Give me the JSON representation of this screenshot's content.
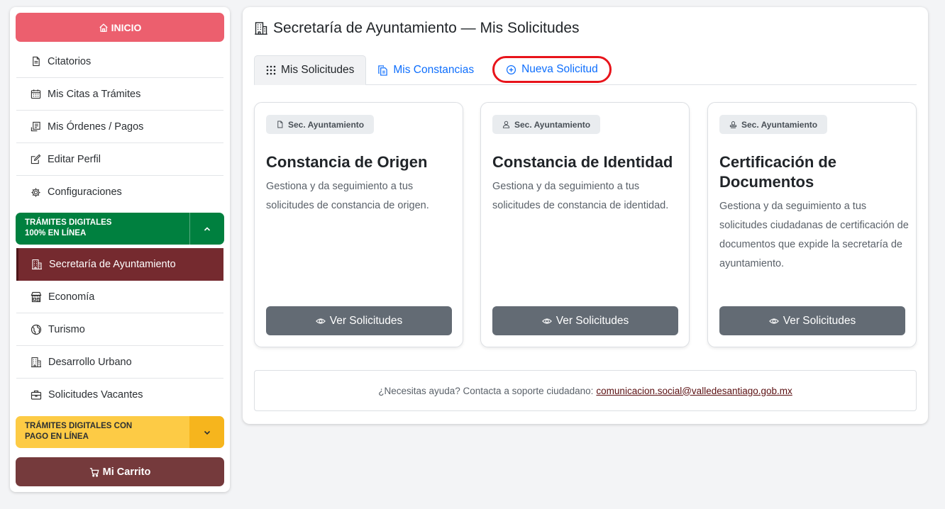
{
  "sidebar": {
    "inicio_label": "INICIO",
    "menu": [
      {
        "label": "Citatorios",
        "icon": "document-icon"
      },
      {
        "label": "Mis Citas a Trámites",
        "icon": "calendar-icon"
      },
      {
        "label": "Mis Órdenes / Pagos",
        "icon": "receipt-icon"
      },
      {
        "label": "Editar Perfil",
        "icon": "edit-icon"
      },
      {
        "label": "Configuraciones",
        "icon": "gear-icon"
      }
    ],
    "section_online": {
      "line1": "TRÁMITES DIGITALES",
      "line2": "100% EN LÍNEA"
    },
    "online_items": [
      {
        "label": "Secretaría de Ayuntamiento",
        "icon": "building-icon"
      },
      {
        "label": "Economía",
        "icon": "shop-icon"
      },
      {
        "label": "Turismo",
        "icon": "globe-icon"
      },
      {
        "label": "Desarrollo Urbano",
        "icon": "building-icon"
      },
      {
        "label": "Solicitudes Vacantes",
        "icon": "briefcase-icon"
      }
    ],
    "section_payment": {
      "line1": "TRÁMITES DIGITALES CON",
      "line2": "PAGO EN LÍNEA"
    },
    "cart_label": "Mi Carrito"
  },
  "main": {
    "title": "Secretaría de Ayuntamiento — Mis Solicitudes",
    "tabs": [
      {
        "label": "Mis Solicitudes"
      },
      {
        "label": "Mis Constancias"
      },
      {
        "label": "Nueva Solicitud"
      }
    ],
    "cards": [
      {
        "badge": "Sec. Ayuntamiento",
        "title": "Constancia de Origen",
        "desc": "Gestiona y da seguimiento a tus solicitudes de constancia de origen.",
        "button": "Ver Solicitudes"
      },
      {
        "badge": "Sec. Ayuntamiento",
        "title": "Constancia de Identidad",
        "desc": "Gestiona y da seguimiento a tus solicitudes de constancia de identidad.",
        "button": "Ver Solicitudes"
      },
      {
        "badge": "Sec. Ayuntamiento",
        "title": "Certificación de Documentos",
        "desc": "Gestiona y da seguimiento a tus solicitudes ciudadanas de certificación de documentos que expide la secretaría de ayuntamiento.",
        "button": "Ver Solicitudes"
      }
    ],
    "help": {
      "text": "¿Necesitas ayuda? Contacta a soporte ciudadano:",
      "email": "comunicacion.social@valledesantiago.gob.mx"
    }
  },
  "colors": {
    "inicio": "#ec5f6e",
    "green_section": "#00803f",
    "yellow_section": "#fdcb45",
    "active_item": "#752a2f",
    "cart": "#753a3c",
    "card_button": "#636b74",
    "link": "#0d6efd",
    "highlight_ring": "#e8141b"
  }
}
